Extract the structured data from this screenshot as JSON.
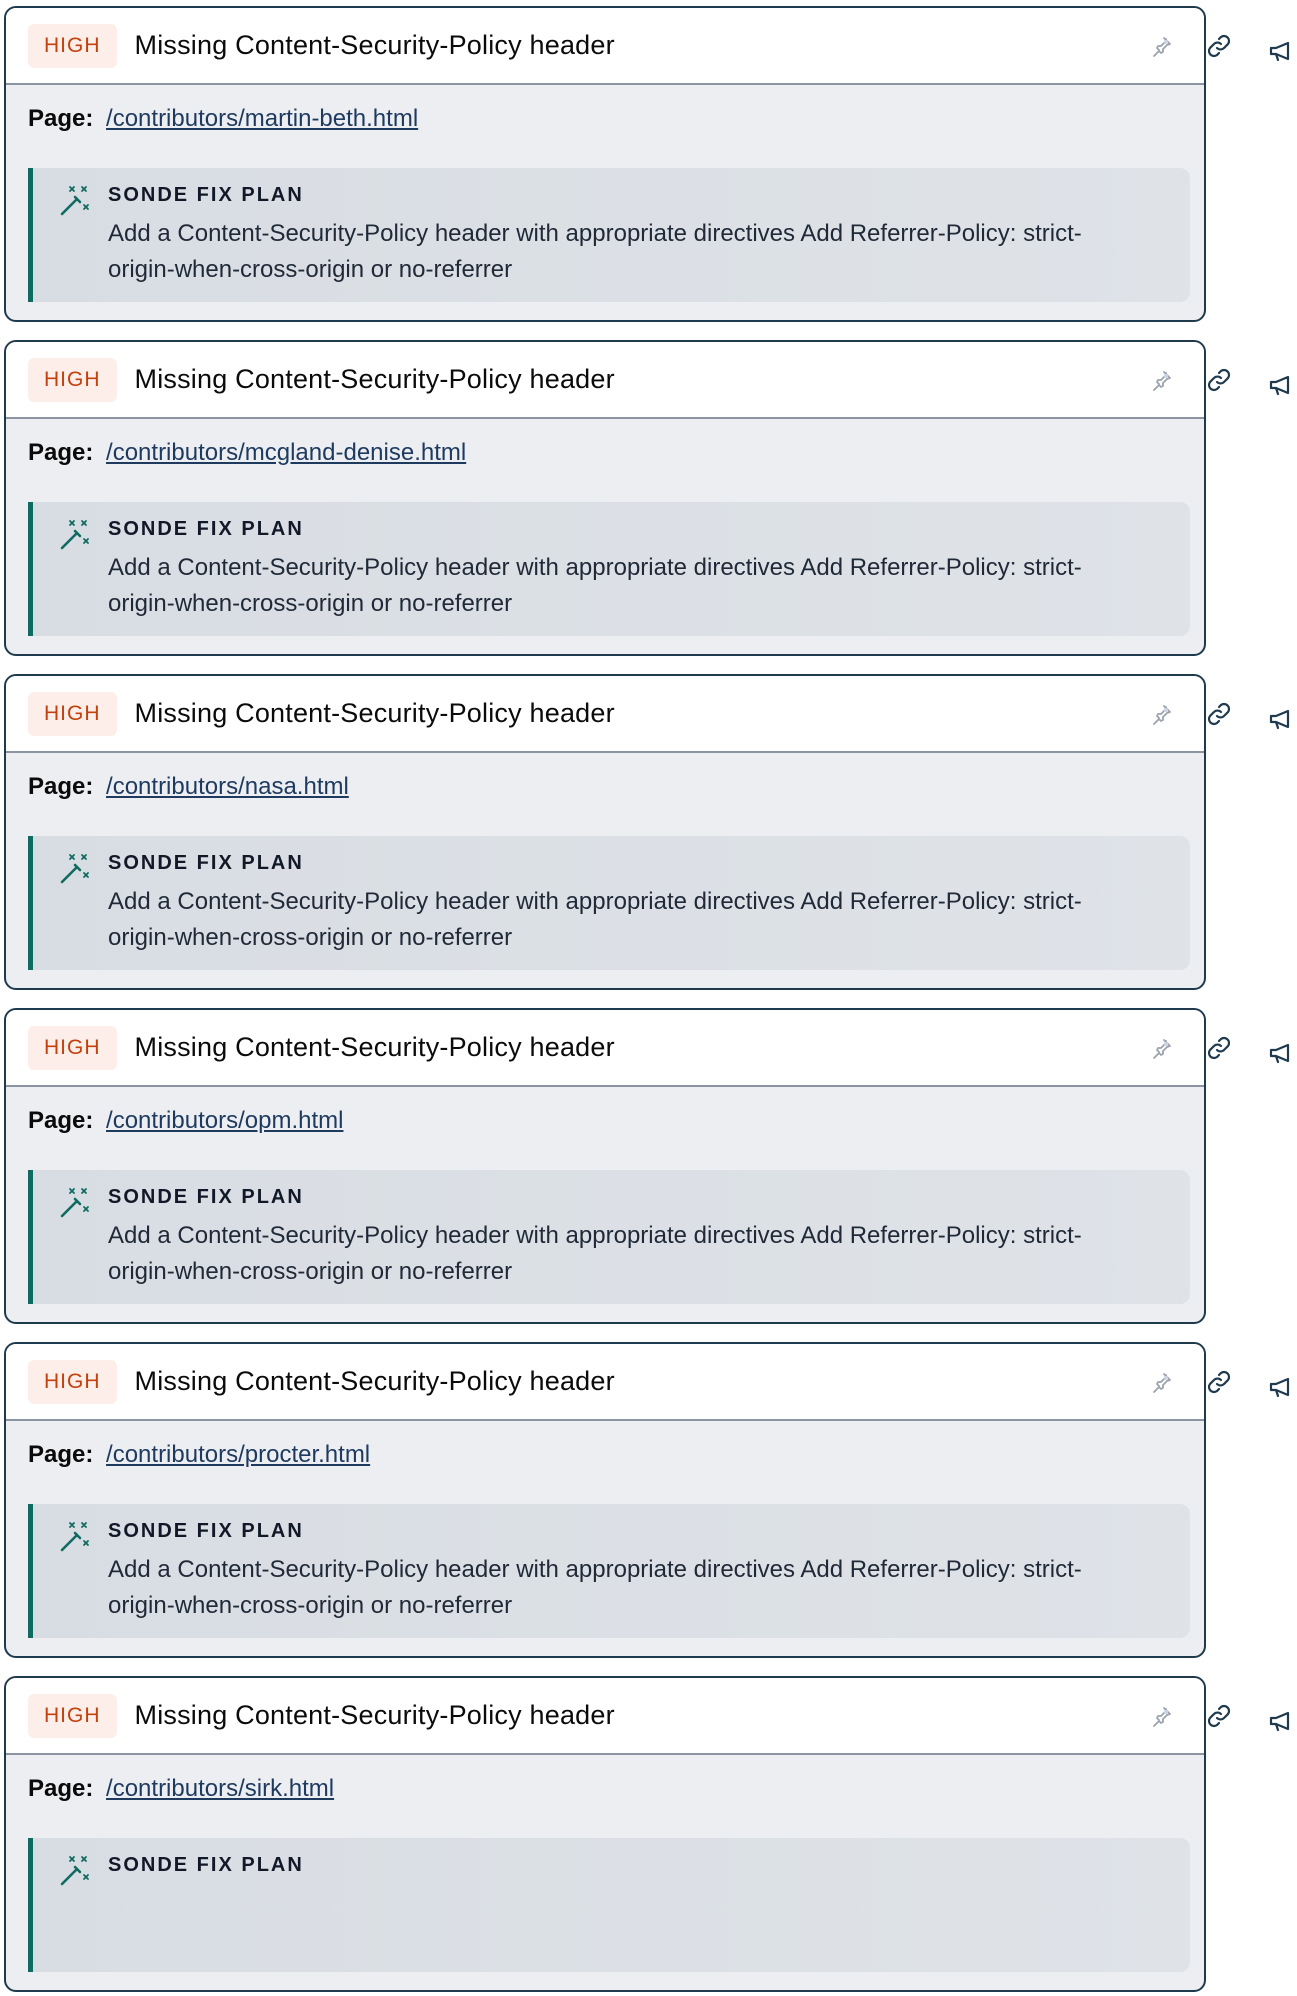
{
  "findings": [
    {
      "severity": "HIGH",
      "title": "Missing Content-Security-Policy header",
      "page_label": "Page:",
      "page_path": "/contributors/martin-beth.html",
      "fix_label": "SONDE FIX PLAN",
      "fix_text": "Add a Content-Security-Policy header with appropriate directives Add Referrer-Policy: strict-origin-when-cross-origin or no-referrer"
    },
    {
      "severity": "HIGH",
      "title": "Missing Content-Security-Policy header",
      "page_label": "Page:",
      "page_path": "/contributors/mcgland-denise.html",
      "fix_label": "SONDE FIX PLAN",
      "fix_text": "Add a Content-Security-Policy header with appropriate directives Add Referrer-Policy: strict-origin-when-cross-origin or no-referrer"
    },
    {
      "severity": "HIGH",
      "title": "Missing Content-Security-Policy header",
      "page_label": "Page:",
      "page_path": "/contributors/nasa.html",
      "fix_label": "SONDE FIX PLAN",
      "fix_text": "Add a Content-Security-Policy header with appropriate directives Add Referrer-Policy: strict-origin-when-cross-origin or no-referrer"
    },
    {
      "severity": "HIGH",
      "title": "Missing Content-Security-Policy header",
      "page_label": "Page:",
      "page_path": "/contributors/opm.html",
      "fix_label": "SONDE FIX PLAN",
      "fix_text": "Add a Content-Security-Policy header with appropriate directives Add Referrer-Policy: strict-origin-when-cross-origin or no-referrer"
    },
    {
      "severity": "HIGH",
      "title": "Missing Content-Security-Policy header",
      "page_label": "Page:",
      "page_path": "/contributors/procter.html",
      "fix_label": "SONDE FIX PLAN",
      "fix_text": "Add a Content-Security-Policy header with appropriate directives Add Referrer-Policy: strict-origin-when-cross-origin or no-referrer"
    },
    {
      "severity": "HIGH",
      "title": "Missing Content-Security-Policy header",
      "page_label": "Page:",
      "page_path": "/contributors/sirk.html",
      "fix_label": "SONDE FIX PLAN",
      "fix_text": ""
    }
  ],
  "icons": {
    "pin": "pin-icon",
    "link": "link-icon",
    "megaphone": "megaphone-icon",
    "wand": "magic-wand-icon"
  },
  "colors": {
    "severity_high_text": "#c2410c",
    "severity_high_bg": "#fdeeea",
    "fix_accent": "#0f6b61",
    "card_border": "#1f3a4d",
    "link": "#1e3a5f"
  }
}
